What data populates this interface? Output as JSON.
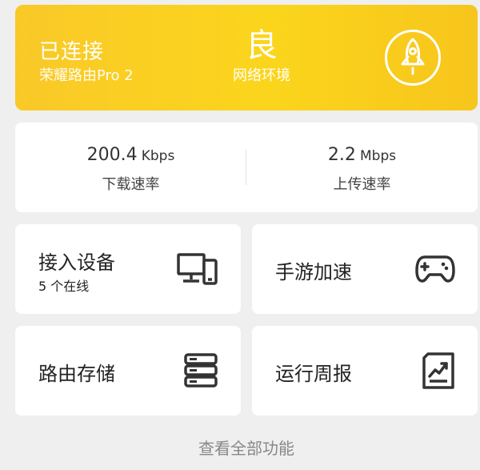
{
  "status": {
    "connection": "已连接",
    "router_name": "荣耀路由Pro 2",
    "quality": "良",
    "quality_label": "网络环境",
    "boost_icon": "rocket-icon"
  },
  "speeds": {
    "download_value": "200.4",
    "download_unit": "Kbps",
    "download_label": "下载速率",
    "upload_value": "2.2",
    "upload_unit": "Mbps",
    "upload_label": "上传速率"
  },
  "tiles": [
    {
      "title": "接入设备",
      "subtitle": "5 个在线",
      "icon": "devices-icon"
    },
    {
      "title": "手游加速",
      "icon": "gamepad-icon"
    },
    {
      "title": "路由存储",
      "icon": "storage-icon"
    },
    {
      "title": "运行周报",
      "icon": "report-chart-icon"
    }
  ],
  "footer": {
    "view_all": "查看全部功能"
  },
  "colors": {
    "accent": "#fbd51c",
    "text": "#222222",
    "muted": "#888888"
  }
}
